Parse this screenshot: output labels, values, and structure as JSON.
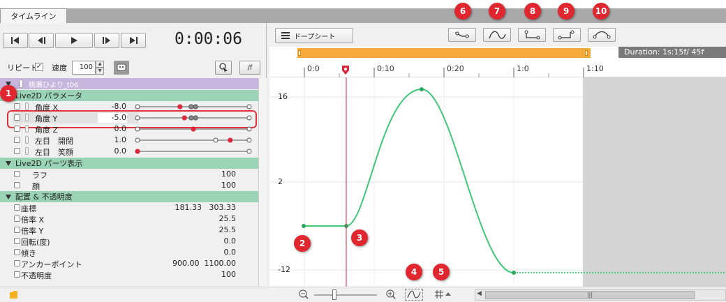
{
  "tab": {
    "label": "タイムライン"
  },
  "playback": {
    "time": "0:00:06"
  },
  "controls": {
    "repeat_label": "リピート",
    "repeat_check": "✓",
    "speed_label": "速度",
    "speed_value": "100",
    "slash_f_label": "/f"
  },
  "object": {
    "name": "桃瀬ひより_t06"
  },
  "groups": [
    {
      "label": "Live2D パラメータ"
    },
    {
      "label": "Live2D パーツ表示"
    },
    {
      "label": "配置 & 不透明度"
    }
  ],
  "live2d_params": [
    {
      "name": "角度 X",
      "value": "-8.0"
    },
    {
      "name": "角度 Y",
      "value": "-5.0"
    },
    {
      "name": "角度 Z",
      "value": "0.0"
    },
    {
      "name": "左目　開閉",
      "value": "1.0"
    },
    {
      "name": "左目　笑顔",
      "value": "0.0"
    }
  ],
  "parts": [
    {
      "name": "ラフ",
      "value": "100"
    },
    {
      "name": "顔",
      "value": "100"
    }
  ],
  "transform": [
    {
      "name": "座標",
      "value": "181.33   303.33"
    },
    {
      "name": "倍率 X",
      "value": "25.5"
    },
    {
      "name": "倍率 Y",
      "value": "25.5"
    },
    {
      "name": "回転(度)",
      "value": "0.0"
    },
    {
      "name": "傾き",
      "value": "0.0"
    },
    {
      "name": "アンカーポイント",
      "value": "900.00  1100.00"
    },
    {
      "name": "不透明度",
      "value": "100"
    }
  ],
  "graph": {
    "dope_sheet_label": "ドープシート",
    "duration": "Duration:  1s:15f/ 45f",
    "ruler_ticks": [
      "0:0",
      "0:10",
      "0:20",
      "1:0",
      "1:10"
    ],
    "y_labels": [
      "16",
      "2",
      "-12"
    ],
    "curve_color": "#3ec878",
    "playhead_color": "#d9263a"
  },
  "markers": [
    "1",
    "2",
    "3",
    "4",
    "5",
    "6",
    "7",
    "8",
    "9",
    "10"
  ],
  "colors": {
    "range_bar": "#f7a93c",
    "param_group": "#9ad3b5",
    "object_row": "#c6b6de",
    "marker": "#e0262e"
  }
}
